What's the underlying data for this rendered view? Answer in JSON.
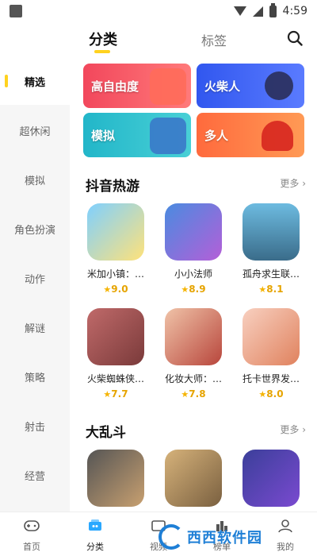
{
  "status_bar": {
    "time": "4:59"
  },
  "top_tabs": {
    "category": "分类",
    "tags": "标签"
  },
  "sidebar": {
    "items": [
      {
        "label": "精选"
      },
      {
        "label": "超休闲"
      },
      {
        "label": "模拟"
      },
      {
        "label": "角色扮演"
      },
      {
        "label": "动作"
      },
      {
        "label": "解谜"
      },
      {
        "label": "策略"
      },
      {
        "label": "射击"
      },
      {
        "label": "经营"
      }
    ]
  },
  "banners": [
    {
      "label": "高自由度",
      "color": "#f45a6a"
    },
    {
      "label": "火柴人",
      "color": "#3f63f2"
    },
    {
      "label": "模拟",
      "color": "#2fc3d6"
    },
    {
      "label": "多人",
      "color": "#ff7a4a"
    }
  ],
  "sections": [
    {
      "title": "抖音热游",
      "more": "更多",
      "games": [
        {
          "name": "米加小镇：…",
          "rating": "9.0"
        },
        {
          "name": "小小法师",
          "rating": "8.9"
        },
        {
          "name": "孤舟求生联…",
          "rating": "8.1"
        },
        {
          "name": "火柴蜘蛛侠…",
          "rating": "7.7"
        },
        {
          "name": "化妆大师：…",
          "rating": "7.8"
        },
        {
          "name": "托卡世界发…",
          "rating": "8.0"
        }
      ]
    },
    {
      "title": "大乱斗",
      "more": "更多"
    }
  ],
  "bottom_nav": [
    {
      "label": "首页"
    },
    {
      "label": "分类"
    },
    {
      "label": "视频"
    },
    {
      "label": "榜单"
    },
    {
      "label": "我的"
    }
  ],
  "watermark": {
    "text": "西西软件园"
  },
  "colors": {
    "accent": "#ffd21f",
    "rating": "#e6a400"
  }
}
